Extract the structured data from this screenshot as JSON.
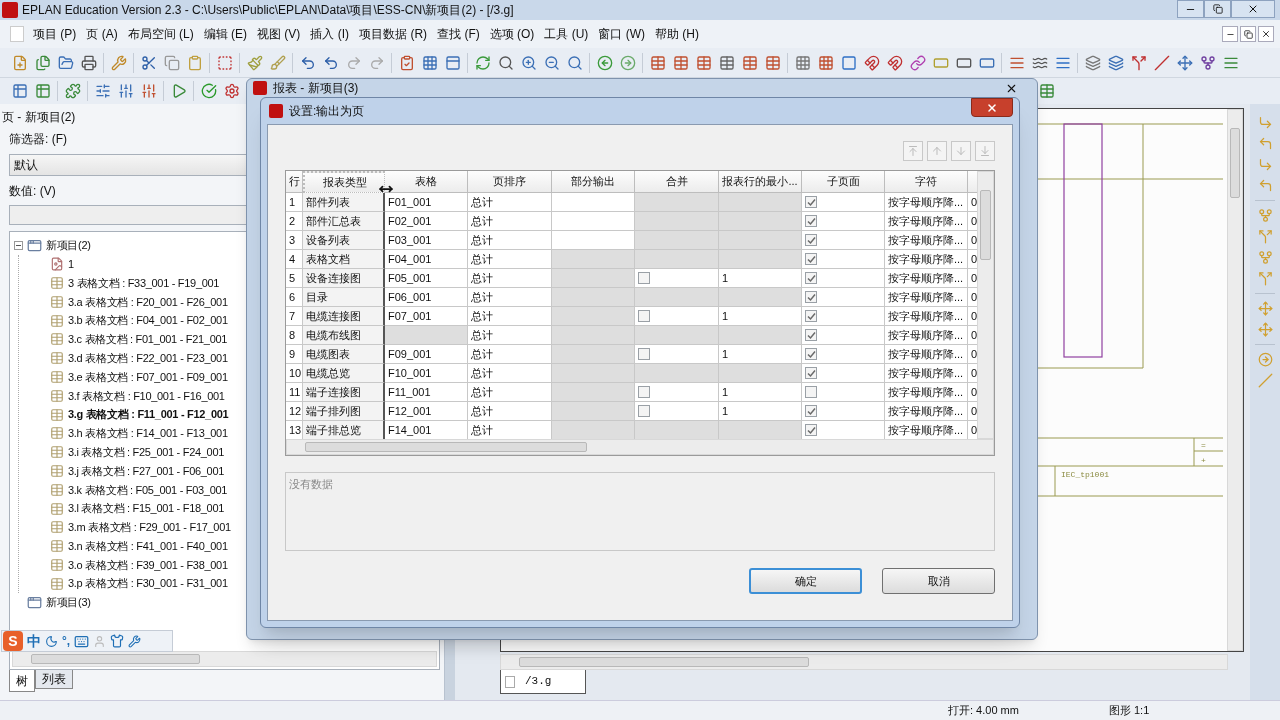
{
  "window": {
    "title": "EPLAN Education Version 2.3 - C:\\Users\\Public\\EPLAN\\Data\\项目\\ESS-CN\\新项目(2) - [/3.g]"
  },
  "menu": [
    "项目 (P)",
    "页 (A)",
    "布局空间 (L)",
    "编辑 (E)",
    "视图 (V)",
    "插入 (I)",
    "项目数据 (R)",
    "查找 (F)",
    "选项 (O)",
    "工具 (U)",
    "窗口 (W)",
    "帮助 (H)"
  ],
  "page_navigator": {
    "title": "页 - 新项目(2)",
    "filter_label": "筛选器: (F)",
    "filter_value": "默认",
    "value_label": "数值: (V)",
    "tree": [
      {
        "label": "新项目(2)",
        "expanded": true,
        "selected": false,
        "children": [
          {
            "label": "1",
            "kind": "graphic",
            "selected": false
          },
          {
            "label": "3 表格文档 : F33_001 - F19_001",
            "kind": "table",
            "selected": false
          },
          {
            "label": "3.a 表格文档 : F20_001 - F26_001",
            "kind": "table",
            "selected": false
          },
          {
            "label": "3.b 表格文档 : F04_001 - F02_001",
            "kind": "table",
            "selected": false
          },
          {
            "label": "3.c 表格文档 : F01_001 - F21_001",
            "kind": "table",
            "selected": false
          },
          {
            "label": "3.d 表格文档 : F22_001 - F23_001",
            "kind": "table",
            "selected": false
          },
          {
            "label": "3.e 表格文档 : F07_001 - F09_001",
            "kind": "table",
            "selected": false
          },
          {
            "label": "3.f 表格文档 : F10_001 - F16_001",
            "kind": "table",
            "selected": false
          },
          {
            "label": "3.g 表格文档 : F11_001 - F12_001",
            "kind": "table",
            "selected": true
          },
          {
            "label": "3.h 表格文档 : F14_001 - F13_001",
            "kind": "table",
            "selected": false
          },
          {
            "label": "3.i 表格文档 : F25_001 - F24_001",
            "kind": "table",
            "selected": false
          },
          {
            "label": "3.j 表格文档 : F27_001 - F06_001",
            "kind": "table",
            "selected": false
          },
          {
            "label": "3.k 表格文档 : F05_001 - F03_001",
            "kind": "table",
            "selected": false
          },
          {
            "label": "3.l 表格文档 : F15_001 - F18_001",
            "kind": "table",
            "selected": false
          },
          {
            "label": "3.m 表格文档 : F29_001 - F17_001",
            "kind": "table",
            "selected": false
          },
          {
            "label": "3.n 表格文档 : F41_001 - F40_001",
            "kind": "table",
            "selected": false
          },
          {
            "label": "3.o 表格文档 : F39_001 - F38_001",
            "kind": "table",
            "selected": false
          },
          {
            "label": "3.p 表格文档 : F30_001 - F31_001",
            "kind": "table",
            "selected": false
          }
        ]
      },
      {
        "label": "新项目(3)",
        "selected": false
      }
    ],
    "tabs": [
      {
        "label": "树",
        "selected": true
      },
      {
        "label": "列表",
        "selected": false
      }
    ]
  },
  "ime_toolbar": {
    "logo": "S",
    "mode": "中",
    "punctuation": "°,"
  },
  "document_tab": {
    "label": "/3.g"
  },
  "canvas": {
    "labels": [
      "=",
      "+",
      "IEC_tp1001"
    ]
  },
  "status_bar": [
    "打开: 4.00 mm",
    "图形 1:1"
  ],
  "report_dialog": {
    "title": "报表 - 新项目(3)"
  },
  "settings_dialog": {
    "title": "设置:输出为页",
    "table": {
      "columns": [
        "行",
        "报表类型",
        "表格",
        "页排序",
        "部分输出",
        "合并",
        "报表行的最小...",
        "子页面",
        "字符"
      ],
      "rows": [
        {
          "num": "1",
          "type": "部件列表",
          "form": "F01_001",
          "sort": "总计",
          "partial_enabled": true,
          "merge_enabled": false,
          "subpage": true,
          "chars": "按字母顺序降...",
          "column_10": "0"
        },
        {
          "num": "2",
          "type": "部件汇总表",
          "form": "F02_001",
          "sort": "总计",
          "partial_enabled": true,
          "merge_enabled": false,
          "subpage": true,
          "chars": "按字母顺序降...",
          "column_10": "0"
        },
        {
          "num": "3",
          "type": "设备列表",
          "form": "F03_001",
          "sort": "总计",
          "partial_enabled": true,
          "merge_enabled": false,
          "subpage": true,
          "chars": "按字母顺序降...",
          "column_10": "0"
        },
        {
          "num": "4",
          "type": "表格文档",
          "form": "F04_001",
          "sort": "总计",
          "partial_enabled": false,
          "merge_enabled": false,
          "subpage": true,
          "chars": "按字母顺序降...",
          "column_10": "0"
        },
        {
          "num": "5",
          "type": "设备连接图",
          "form": "F05_001",
          "sort": "总计",
          "partial_enabled": false,
          "merge_enabled": true,
          "merge_checked": false,
          "min_rows": "1",
          "subpage": true,
          "chars": "按字母顺序降...",
          "column_10": "0"
        },
        {
          "num": "6",
          "type": "目录",
          "form": "F06_001",
          "sort": "总计",
          "partial_enabled": false,
          "merge_enabled": false,
          "subpage": true,
          "chars": "按字母顺序降...",
          "column_10": "0"
        },
        {
          "num": "7",
          "type": "电缆连接图",
          "form": "F07_001",
          "sort": "总计",
          "partial_enabled": false,
          "merge_enabled": true,
          "merge_checked": false,
          "min_rows": "1",
          "subpage": true,
          "chars": "按字母顺序降...",
          "column_10": "0"
        },
        {
          "num": "8",
          "type": "电缆布线图",
          "sort": "总计",
          "partial_enabled": false,
          "merge_enabled": false,
          "subpage": true,
          "chars": "按字母顺序降...",
          "column_10": "0"
        },
        {
          "num": "9",
          "type": "电缆图表",
          "form": "F09_001",
          "sort": "总计",
          "partial_enabled": false,
          "merge_enabled": true,
          "merge_checked": false,
          "min_rows": "1",
          "subpage": true,
          "chars": "按字母顺序降...",
          "column_10": "0"
        },
        {
          "num": "10",
          "type": "电缆总览",
          "form": "F10_001",
          "sort": "总计",
          "partial_enabled": false,
          "merge_enabled": false,
          "subpage": true,
          "chars": "按字母顺序降...",
          "column_10": "0"
        },
        {
          "num": "11",
          "type": "端子连接图",
          "form": "F11_001",
          "sort": "总计",
          "partial_enabled": false,
          "merge_enabled": true,
          "merge_checked": false,
          "min_rows": "1",
          "subpage": false,
          "chars": "按字母顺序降...",
          "column_10": "0"
        },
        {
          "num": "12",
          "type": "端子排列图",
          "form": "F12_001",
          "sort": "总计",
          "partial_enabled": false,
          "merge_enabled": true,
          "merge_checked": false,
          "min_rows": "1",
          "subpage": true,
          "chars": "按字母顺序降...",
          "column_10": "0"
        },
        {
          "num": "13",
          "type": "端子排总览",
          "form": "F14_001",
          "sort": "总计",
          "partial_enabled": false,
          "merge_enabled": false,
          "subpage": true,
          "chars": "按字母顺序降...",
          "column_10": "0"
        }
      ]
    },
    "description": "没有数据",
    "buttons": [
      {
        "label": "确定",
        "default": true
      },
      {
        "label": "取消",
        "default": false
      }
    ]
  }
}
